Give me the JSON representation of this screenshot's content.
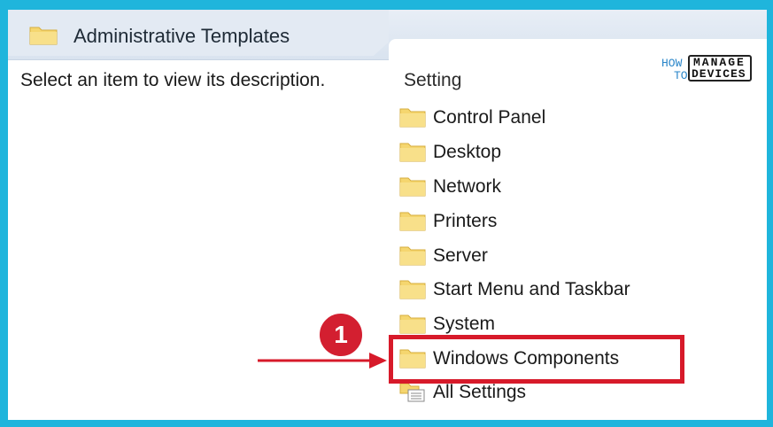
{
  "header": {
    "title": "Administrative Templates",
    "icon": "folder-icon"
  },
  "left_pane": {
    "description": "Select an item to view its description."
  },
  "right_pane": {
    "column_header": "Setting",
    "items": [
      {
        "label": "Control Panel",
        "icon": "folder-icon"
      },
      {
        "label": "Desktop",
        "icon": "folder-icon"
      },
      {
        "label": "Network",
        "icon": "folder-icon"
      },
      {
        "label": "Printers",
        "icon": "folder-icon"
      },
      {
        "label": "Server",
        "icon": "folder-icon"
      },
      {
        "label": "Start Menu and Taskbar",
        "icon": "folder-icon"
      },
      {
        "label": "System",
        "icon": "folder-icon"
      },
      {
        "label": "Windows Components",
        "icon": "folder-icon"
      },
      {
        "label": "All Settings",
        "icon": "settings-list-icon"
      }
    ]
  },
  "annotation": {
    "step_number": "1",
    "highlighted_item": "Windows Components",
    "accent_color": "#d71a2a"
  },
  "logo": {
    "how": "HOW",
    "to": "TO",
    "manage": "MANAGE",
    "devices": "DEVICES"
  },
  "colors": {
    "border": "#1fb5dc",
    "folder": "#f5d66f",
    "folder_edge": "#d6ad3e"
  }
}
